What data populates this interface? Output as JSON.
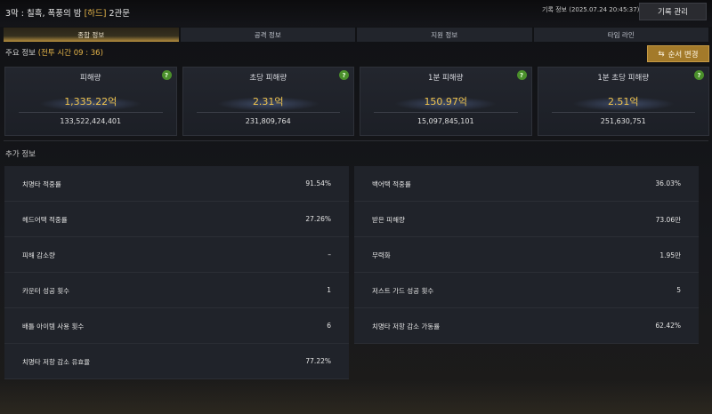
{
  "header": {
    "title_prefix": "3막 : 칠흑, 폭풍의 밤",
    "difficulty": "[하드]",
    "gate": "2관문",
    "record_info": "기록 정보 (2025.07.24 20:45:37)",
    "record_button": "기록 관리"
  },
  "tabs": [
    {
      "label": "종합 정보",
      "active": true
    },
    {
      "label": "공격 정보",
      "active": false
    },
    {
      "label": "지원 정보",
      "active": false
    },
    {
      "label": "타임 라인",
      "active": false
    }
  ],
  "summary": {
    "label": "주요 정보",
    "battle_time": "(전투 시간 09 : 36)",
    "order_button": "순서 변경"
  },
  "cards": [
    {
      "title": "피해량",
      "big": "1,335.22억",
      "small": "133,522,424,401"
    },
    {
      "title": "초당 피해량",
      "big": "2.31억",
      "small": "231,809,764"
    },
    {
      "title": "1분 피해량",
      "big": "150.97억",
      "small": "15,097,845,101"
    },
    {
      "title": "1분 초당 피해량",
      "big": "2.51억",
      "small": "251,630,751"
    }
  ],
  "extra": {
    "label": "추가 정보",
    "rows": [
      [
        {
          "label": "치명타 적중률",
          "value": "91.54%"
        },
        {
          "label": "백어택 적중률",
          "value": "36.03%"
        }
      ],
      [
        {
          "label": "헤드어택 적중률",
          "value": "27.26%"
        },
        {
          "label": "받은 피해량",
          "value": "73.06만"
        }
      ],
      [
        {
          "label": "피해 감소량",
          "value": "–"
        },
        {
          "label": "무력화",
          "value": "1.95만"
        }
      ],
      [
        {
          "label": "카운터 성공 횟수",
          "value": "1"
        },
        {
          "label": "저스트 가드 성공 횟수",
          "value": "5"
        }
      ],
      [
        {
          "label": "배틀 아이템 사용 횟수",
          "value": "6"
        },
        {
          "label": "치명타 저항 감소 가동률",
          "value": "62.42%"
        }
      ],
      [
        {
          "label": "치명타 저항 감소 유효율",
          "value": "77.22%"
        }
      ]
    ]
  },
  "colors": {
    "accent_gold": "#f0c44e",
    "help_green": "#4a8f2b",
    "order_button": "#a37a2a"
  }
}
